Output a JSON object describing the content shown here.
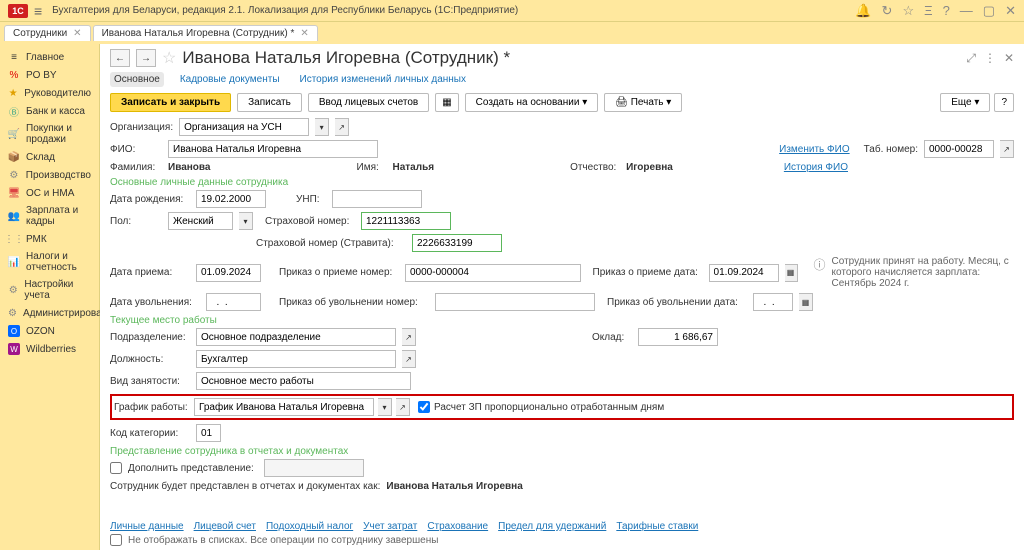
{
  "app": {
    "title": "Бухгалтерия для Беларуси, редакция 2.1. Локализация для Республики Беларусь   (1С:Предприятие)",
    "logo": "1С"
  },
  "tabs": [
    {
      "label": "Сотрудники"
    },
    {
      "label": "Иванова Наталья Игоревна (Сотрудник) *"
    }
  ],
  "sidebar": [
    {
      "icon": "≡",
      "label": "Главное"
    },
    {
      "icon": "%",
      "label": "PO BY"
    },
    {
      "icon": "★",
      "label": "Руководителю"
    },
    {
      "icon": "Ⓑ",
      "label": "Банк и касса"
    },
    {
      "icon": "🛒",
      "label": "Покупки и продажи"
    },
    {
      "icon": "📦",
      "label": "Склад"
    },
    {
      "icon": "⚙",
      "label": "Производство"
    },
    {
      "icon": "🖥",
      "label": "ОС и НМА"
    },
    {
      "icon": "👥",
      "label": "Зарплата и кадры"
    },
    {
      "icon": "⋮⋮",
      "label": "РМК"
    },
    {
      "icon": "📊",
      "label": "Налоги и отчетность"
    },
    {
      "icon": "⚙",
      "label": "Настройки учета"
    },
    {
      "icon": "⚙",
      "label": "Администрирование"
    },
    {
      "icon": "O",
      "label": "OZON"
    },
    {
      "icon": "W",
      "label": "Wildberries"
    }
  ],
  "page": {
    "title": "Иванова Наталья Игоревна (Сотрудник) *",
    "subtabs": [
      {
        "label": "Основное",
        "active": true
      },
      {
        "label": "Кадровые документы"
      },
      {
        "label": "История изменений личных данных"
      }
    ],
    "toolbar": {
      "save_close": "Записать и закрыть",
      "save": "Записать",
      "accounts": "Ввод лицевых счетов",
      "create_based": "Создать на основании",
      "print": "Печать",
      "more": "Еще"
    }
  },
  "form": {
    "org_lbl": "Организация:",
    "org_val": "Организация на УСН",
    "fio_lbl": "ФИО:",
    "fio_val": "Иванова Наталья Игоревна",
    "change_fio": "Изменить ФИО",
    "history_fio": "История ФИО",
    "tabnum_lbl": "Таб. номер:",
    "tabnum_val": "0000-00028",
    "fam_lbl": "Фамилия:",
    "fam_val": "Иванова",
    "name_lbl": "Имя:",
    "name_val": "Наталья",
    "patr_lbl": "Отчество:",
    "patr_val": "Игоревна",
    "personal_section": "Основные личные данные сотрудника",
    "birth_lbl": "Дата рождения:",
    "birth_val": "19.02.2000",
    "unp_lbl": "УНП:",
    "sex_lbl": "Пол:",
    "sex_val": "Женский",
    "ins_lbl": "Страховой номер:",
    "ins_val": "1221113363",
    "ins2_lbl": "Страховой номер (Стравита):",
    "ins2_val": "2226633199",
    "hire_lbl": "Дата приема:",
    "hire_val": "01.09.2024",
    "hire_order_lbl": "Приказ о приеме номер:",
    "hire_order_val": "0000-000004",
    "hire_order_date_lbl": "Приказ о приеме дата:",
    "hire_order_date_val": "01.09.2024",
    "info_text": "Сотрудник принят на работу. Месяц, с которого начисляется зарплата: Сентябрь 2024 г.",
    "fire_lbl": "Дата увольнения:",
    "fire_val": "  .  .    ",
    "fire_order_lbl": "Приказ об увольнении номер:",
    "fire_order_date_lbl": "Приказ об увольнении дата:",
    "fire_order_date_val": "  .  .    ",
    "workplace_section": "Текущее место работы",
    "dept_lbl": "Подразделение:",
    "dept_val": "Основное подразделение",
    "salary_lbl": "Оклад:",
    "salary_val": "1 686,67",
    "pos_lbl": "Должность:",
    "pos_val": "Бухгалтер",
    "occ_lbl": "Вид занятости:",
    "occ_val": "Основное место работы",
    "sched_lbl": "График работы:",
    "sched_val": "График Иванова Наталья Игоревна",
    "prop_calc": "Расчет ЗП пропорционально отработанным дням",
    "cat_lbl": "Код категории:",
    "cat_val": "01",
    "present_section": "Представление сотрудника в отчетах и документах",
    "ext_present": "Дополнить представление:",
    "present_text_lbl": "Сотрудник будет представлен в отчетах и документах как:",
    "present_text_val": "Иванова Наталья Игоревна"
  },
  "bottom_links": [
    "Личные данные",
    "Лицевой счет",
    "Подоходный налог",
    "Учет затрат",
    "Страхование",
    "Предел для удержаний",
    "Тарифные ставки"
  ],
  "footer_text": "Не отображать в списках. Все операции по сотруднику завершены"
}
